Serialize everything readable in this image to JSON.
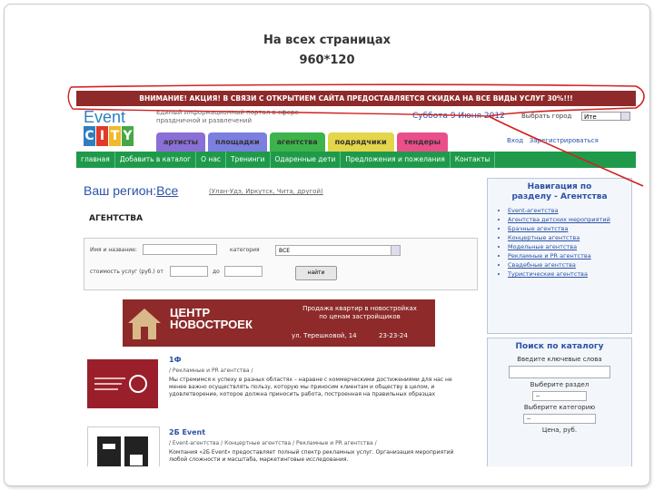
{
  "slide": {
    "title_line1": "На всех страницах",
    "title_line2": "960*120"
  },
  "banner": {
    "text": "ВНИМАНИЕ! АКЦИЯ! В СВЯЗИ С ОТКРЫТИЕМ САЙТА ПРЕДОСТАВЛЯЕТСЯ СКИДКА НА ВСЕ ВИДЫ УСЛУГ 30%!!!"
  },
  "header": {
    "logo_top": "Event",
    "logo_letters": [
      "C",
      "I",
      "T",
      "Y"
    ],
    "logo_colors": [
      "#2f7fc0",
      "#e03a2a",
      "#f0b92a",
      "#45a845"
    ],
    "tagline": "Единый информационный портал в сфере праздничной и развлечений",
    "date": "Суббота 9 Июня 2012",
    "city_label": "Выбрать город",
    "city_value": "Ите",
    "login": "Вход",
    "register": "Зарегистрироваться"
  },
  "tabs": [
    {
      "label": "артисты",
      "color": "#8a6fd6"
    },
    {
      "label": "площадки",
      "color": "#7b7fe0"
    },
    {
      "label": "агентства",
      "color": "#3cb44b"
    },
    {
      "label": "подрядчики",
      "color": "#e3d64a"
    },
    {
      "label": "тендеры",
      "color": "#ea4f8a"
    }
  ],
  "nav": [
    "главная",
    "Добавить в каталог",
    "О нас",
    "Тренинги",
    "Одаренные дети",
    "Предложения и пожелания",
    "Контакты"
  ],
  "region": {
    "label": "Ваш регион:",
    "value": "Все",
    "links": "(Улан-Удэ, Иркутск, Чита, другой)"
  },
  "section": {
    "title": "АГЕНТСТВА"
  },
  "search": {
    "name_label": "Имя и название:",
    "category_label": "категория",
    "category_value": "ВСЕ",
    "cost_label": "стоимость услуг (руб.) от",
    "to_label": "до",
    "button": "найти"
  },
  "ad": {
    "title_line1": "ЦЕНТР",
    "title_line2": "НОВОСТРОЕК",
    "slogan_line1": "Продажа квартир в новостройках",
    "slogan_line2": "по ценам застройщиков",
    "address": "ул. Терешковой, 14",
    "phone": "23-23-24"
  },
  "items": [
    {
      "name": "1Ф",
      "category": "/ Рекламные и PR агентства /",
      "desc": "Мы стремимся к успеху в разных областях – наравне с коммерческими достижениями для нас не менее важно осуществлять пользу, которую мы приносим клиентам и обществу в целом, и удовлетворение, которое должна приносить работа, построенная на правильных образцах"
    },
    {
      "name": "2Б Event",
      "category": "/ Event-агентства / Концертные агентства / Рекламные и PR агентства /",
      "desc": "Компания «2Б Event» предоставляет полный спектр рекламных услуг. Организация мероприятий любой сложности и масштаба, маркетинговые исследования."
    }
  ],
  "sidebar_nav": {
    "title_line1": "Навигация по",
    "title_line2": "разделу - Агентства",
    "items": [
      "Event-агентства",
      "Агентства детских мероприятий",
      "Брачные агентства",
      "Концертные агентства",
      "Модельные агентства",
      "Рекламные и PR агентства",
      "Свадебные агентства",
      "Туристические агентства"
    ]
  },
  "sidebar_search": {
    "title": "Поиск по каталогу",
    "keyword_label": "Введите ключевые слова",
    "section_label": "Выберите раздел",
    "section_value": "--",
    "category_label": "Выберите категорию",
    "category_value": "--",
    "price_label": "Цена, руб."
  }
}
